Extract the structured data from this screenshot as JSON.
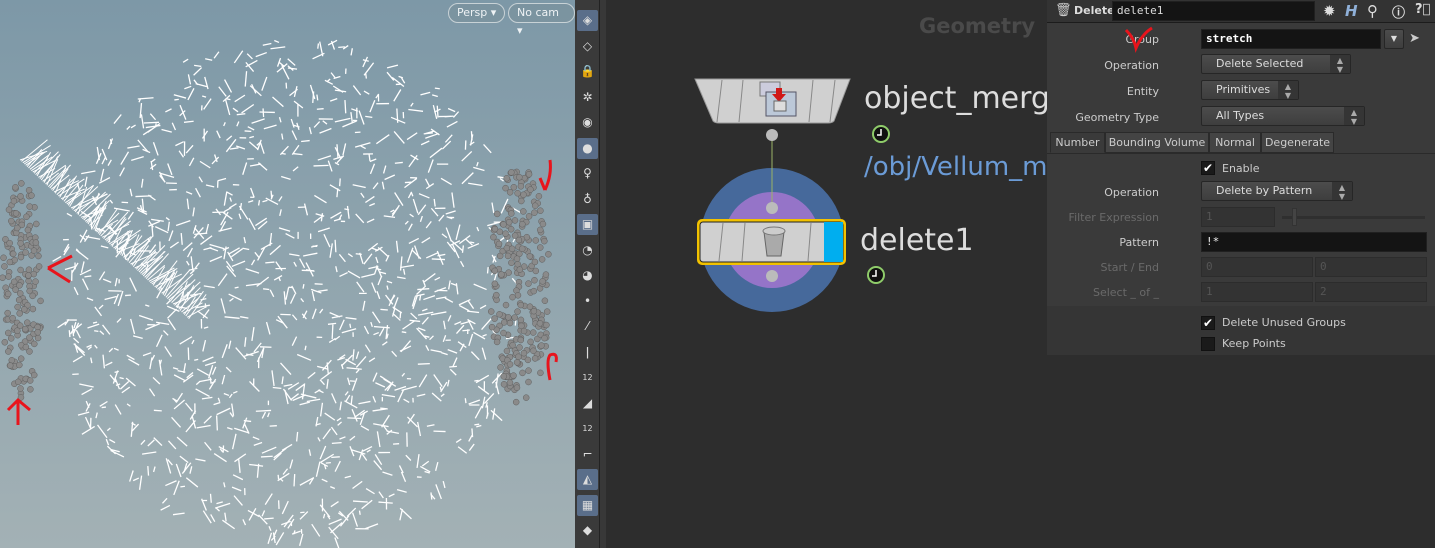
{
  "viewport": {
    "projection_menu": "Persp",
    "camera_menu": "No cam"
  },
  "toolbar": {
    "icons": [
      "display-options-icon",
      "ghost-icon",
      "lock-icon",
      "light-off-icon",
      "shading-icon",
      "headlight-icon",
      "light-icon",
      "light-shadow-icon",
      "cube-icon",
      "eye-icon",
      "camera-icon",
      "point-icon",
      "point-normal-icon",
      "vertex-icon",
      "point-number-12-icon",
      "primitive-icon",
      "primitive-number-12-icon",
      "edge-icon",
      "backface-icon",
      "checker-icon",
      "diamond-icon"
    ],
    "point_number_label": "12",
    "prim_number_label": "12"
  },
  "network": {
    "context_label": "Geometry",
    "nodes": [
      {
        "name": "object_merge",
        "subtitle": "/obj/Vellum_me",
        "type": "object-merge"
      },
      {
        "name": "delete1",
        "type": "delete",
        "selected": true,
        "display_flag_color": "#00aeef"
      }
    ],
    "colors": {
      "selection_outline": "#f2c200",
      "highlight_outer": "#46699b",
      "highlight_inner": "#9574c8",
      "subtitle": "#6b9bd6",
      "wire": "#9ab466"
    }
  },
  "parms": {
    "node_type": "Delete",
    "node_name": "delete1",
    "group": {
      "label": "Group",
      "value": "stretch"
    },
    "operation": {
      "label": "Operation",
      "value": "Delete Selected"
    },
    "entity": {
      "label": "Entity",
      "value": "Primitives"
    },
    "geometry_type": {
      "label": "Geometry Type",
      "value": "All Types"
    },
    "tabs": [
      "Number",
      "Bounding Volume",
      "Normal",
      "Degenerate"
    ],
    "active_tab": "Number",
    "number": {
      "enable": {
        "label": "Enable",
        "checked": true
      },
      "operation": {
        "label": "Operation",
        "value": "Delete by Pattern"
      },
      "filter_expression": {
        "label": "Filter Expression",
        "value": "1"
      },
      "pattern": {
        "label": "Pattern",
        "value": "!*"
      },
      "start_end": {
        "label": "Start / End",
        "start": "0",
        "end": "0"
      },
      "select_of": {
        "label": "Select _ of _",
        "a": "1",
        "b": "2"
      }
    },
    "delete_unused_groups": {
      "label": "Delete Unused Groups",
      "checked": true
    },
    "keep_points": {
      "label": "Keep Points",
      "checked": false
    },
    "check_glyph": "✔"
  },
  "annotations": {
    "color": "#e8141c"
  }
}
